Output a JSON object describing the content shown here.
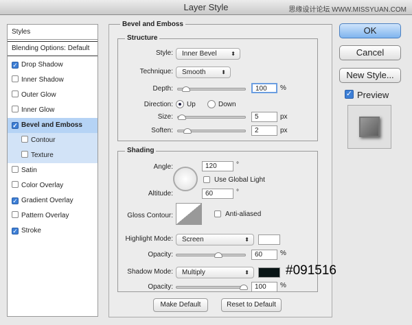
{
  "window": {
    "title": "Layer Style",
    "watermark": "思缘设计论坛 WWW.MISSYUAN.COM"
  },
  "sidebar": {
    "header": "Styles",
    "blending": "Blending Options: Default",
    "items": [
      {
        "label": "Drop Shadow",
        "checked": true
      },
      {
        "label": "Inner Shadow",
        "checked": false
      },
      {
        "label": "Outer Glow",
        "checked": false
      },
      {
        "label": "Inner Glow",
        "checked": false
      },
      {
        "label": "Bevel and Emboss",
        "checked": true
      },
      {
        "label": "Contour",
        "checked": false
      },
      {
        "label": "Texture",
        "checked": false
      },
      {
        "label": "Satin",
        "checked": false
      },
      {
        "label": "Color Overlay",
        "checked": false
      },
      {
        "label": "Gradient Overlay",
        "checked": true
      },
      {
        "label": "Pattern Overlay",
        "checked": false
      },
      {
        "label": "Stroke",
        "checked": true
      }
    ]
  },
  "panel": {
    "title": "Bevel and Emboss",
    "structure": {
      "title": "Structure",
      "style_label": "Style:",
      "style": "Inner Bevel",
      "technique_label": "Technique:",
      "technique": "Smooth",
      "depth_label": "Depth:",
      "depth": "100",
      "pct": "%",
      "direction_label": "Direction:",
      "up": "Up",
      "down": "Down",
      "size_label": "Size:",
      "size": "5",
      "px": "px",
      "soften_label": "Soften:",
      "soften": "2"
    },
    "shading": {
      "title": "Shading",
      "angle_label": "Angle:",
      "angle": "120",
      "deg": "°",
      "global_light": "Use Global Light",
      "altitude_label": "Altitude:",
      "altitude": "60",
      "gloss_label": "Gloss Contour:",
      "anti_aliased": "Anti-aliased",
      "highlight_label": "Highlight Mode:",
      "highlight_mode": "Screen",
      "highlight_color": "#ffffff",
      "opacity_label": "Opacity:",
      "highlight_opacity": "60",
      "shadow_label": "Shadow Mode:",
      "shadow_mode": "Multiply",
      "shadow_color": "#091516",
      "shadow_hex": "#091516",
      "shadow_opacity": "100"
    },
    "make_default": "Make Default",
    "reset_default": "Reset to Default"
  },
  "buttons": {
    "ok": "OK",
    "cancel": "Cancel",
    "new_style": "New Style...",
    "preview": "Preview"
  }
}
